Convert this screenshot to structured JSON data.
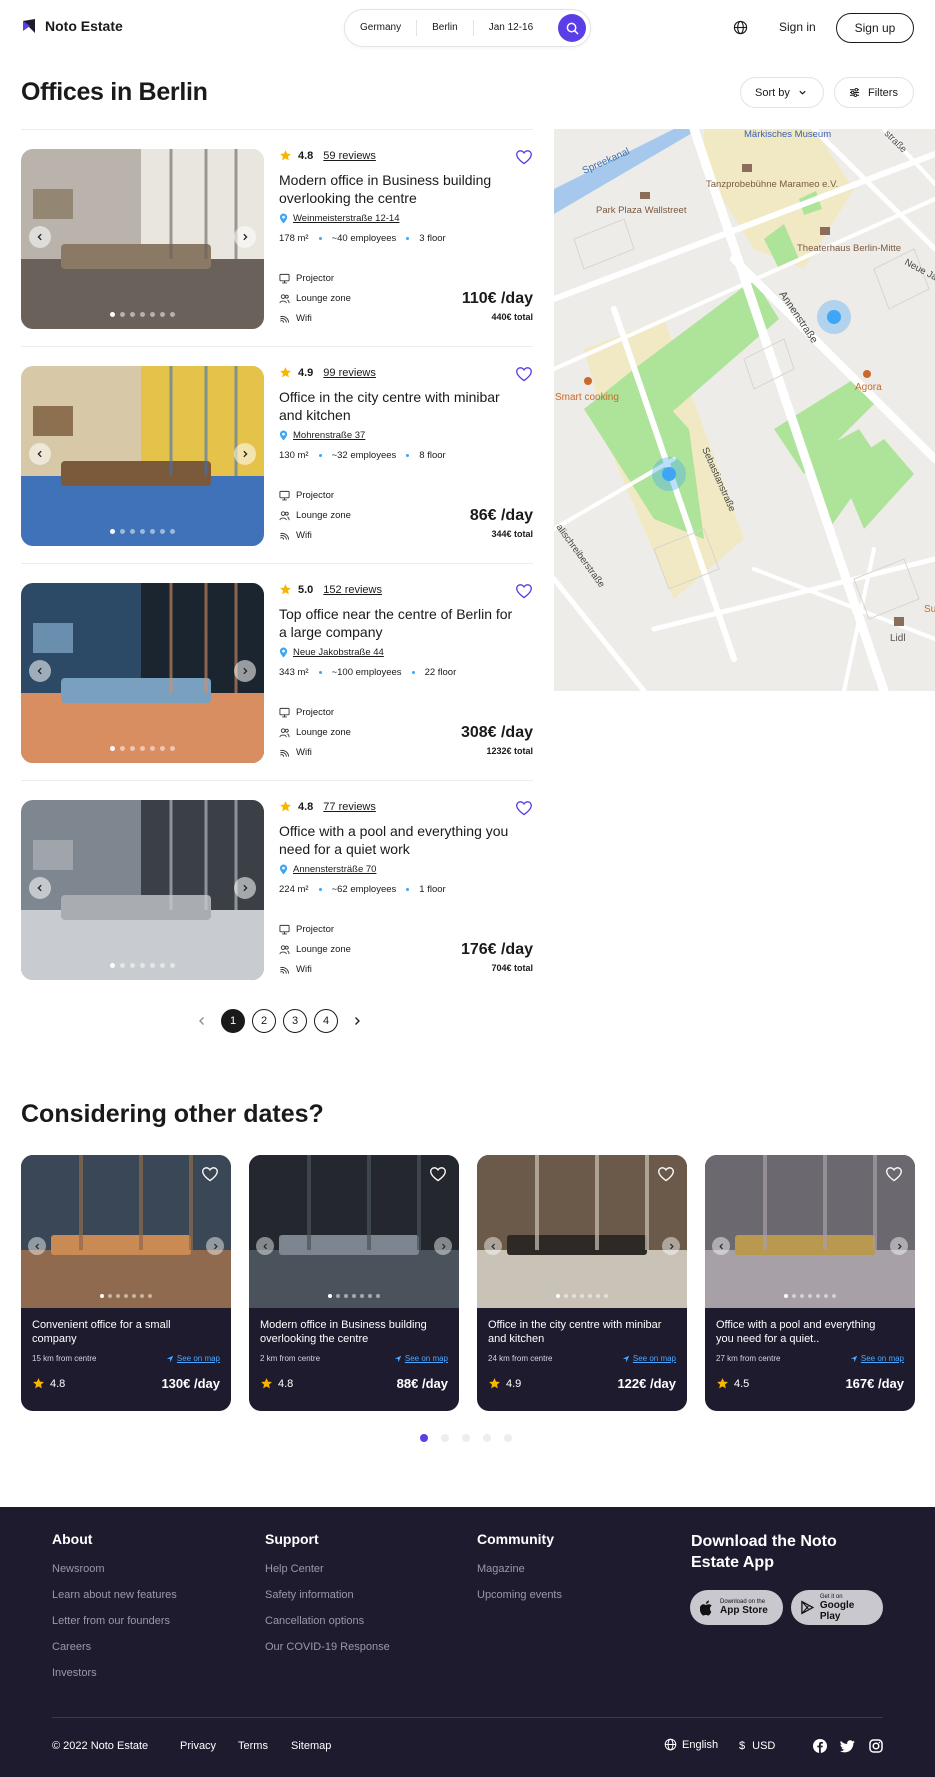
{
  "header": {
    "logo": "Noto Estate",
    "search": {
      "country": "Germany",
      "city": "Berlin",
      "dates": "Jan 12-16"
    },
    "signin": "Sign in",
    "signup": "Sign up"
  },
  "page_title": "Offices in Berlin",
  "sort_label": "Sort by",
  "filters_label": "Filters",
  "listings": [
    {
      "rating": "4.8",
      "reviews": "59 reviews",
      "title": "Modern office in Business building overlooking the centre",
      "address": "Weinmeisterstraße 12-14",
      "area": "178 m²",
      "employees": "~40 employees",
      "floor": "3 floor",
      "features": [
        "Projector",
        "Lounge zone",
        "Wifi"
      ],
      "price": "110€ /day",
      "total": "440€ total"
    },
    {
      "rating": "4.9",
      "reviews": "99 reviews",
      "title": "Office in the city centre with minibar and kitchen",
      "address": "Mohrenstraße 37",
      "area": "130 m²",
      "employees": "~32 employees",
      "floor": "8 floor",
      "features": [
        "Projector",
        "Lounge zone",
        "Wifi"
      ],
      "price": "86€ /day",
      "total": "344€ total"
    },
    {
      "rating": "5.0",
      "reviews": "152 reviews",
      "title": "Top office near the centre of Berlin for a large company",
      "address": "Neue Jakobstraße 44",
      "area": "343 m²",
      "employees": "~100 employees",
      "floor": "22 floor",
      "features": [
        "Projector",
        "Lounge zone",
        "Wifi"
      ],
      "price": "308€ /day",
      "total": "1232€ total"
    },
    {
      "rating": "4.8",
      "reviews": "77 reviews",
      "title": "Office with a pool and everything you need for a quiet work",
      "address": "Annenstersträße 70",
      "area": "224 m²",
      "employees": "~62 employees",
      "floor": "1 floor",
      "features": [
        "Projector",
        "Lounge zone",
        "Wifi"
      ],
      "price": "176€ /day",
      "total": "704€ total"
    }
  ],
  "pagination": {
    "pages": [
      "1",
      "2",
      "3",
      "4"
    ],
    "current": "1"
  },
  "map": {
    "labels": {
      "spreekanal": "Spreekanal",
      "museum": "Märkisches Museum",
      "tanz": "Tanzprobebühne Marameo e.V.",
      "park": "Park Plaza Wallstreet",
      "theater": "Theaterhaus Berlin-Mitte",
      "neue": "Neue Ja",
      "annen": "Annenstraße",
      "strasse_top": "straße",
      "agora": "Agora",
      "smart": "Smart cooking",
      "sebastian": "Sebastianstraße",
      "alisch": "alischreiberstraße",
      "lidl": "Lidl",
      "su": "Su"
    }
  },
  "other_dates": {
    "title": "Considering other dates?",
    "see_on_map": "See on map",
    "cards": [
      {
        "title": "Convenient office for a small company",
        "distance": "15 km from centre",
        "rating": "4.8",
        "price": "130€ /day"
      },
      {
        "title": "Modern office in Business building overlooking the centre",
        "distance": "2 km from centre",
        "rating": "4.8",
        "price": "88€ /day"
      },
      {
        "title": "Office in the city centre with minibar and kitchen",
        "distance": "24 km from centre",
        "rating": "4.9",
        "price": "122€ /day"
      },
      {
        "title": "Office with a pool and everything you need for a quiet..",
        "distance": "27 km from centre",
        "rating": "4.5",
        "price": "167€ /day"
      }
    ]
  },
  "footer": {
    "about": {
      "title": "About",
      "links": [
        "Newsroom",
        "Learn about new features",
        "Letter from our founders",
        "Careers",
        "Investors"
      ]
    },
    "support": {
      "title": "Support",
      "links": [
        "Help Center",
        "Safety information",
        "Cancellation options",
        "Our COVID-19 Response"
      ]
    },
    "community": {
      "title": "Community",
      "links": [
        "Magazine",
        "Upcoming events"
      ]
    },
    "app": {
      "title": "Download the Noto Estate App",
      "appstore_small": "Download on the",
      "appstore": "App Store",
      "gplay_small": "Get it on",
      "gplay": "Google Play"
    },
    "copyright": "© 2022 Noto Estate",
    "privacy": "Privacy",
    "terms": "Terms",
    "sitemap": "Sitemap",
    "language": "English",
    "currency_symbol": "$",
    "currency": "USD"
  },
  "colors": {
    "accent": "#5b3ee6",
    "dark": "#1e1b2e",
    "star": "#f7b500",
    "link": "#4aa7ff"
  }
}
